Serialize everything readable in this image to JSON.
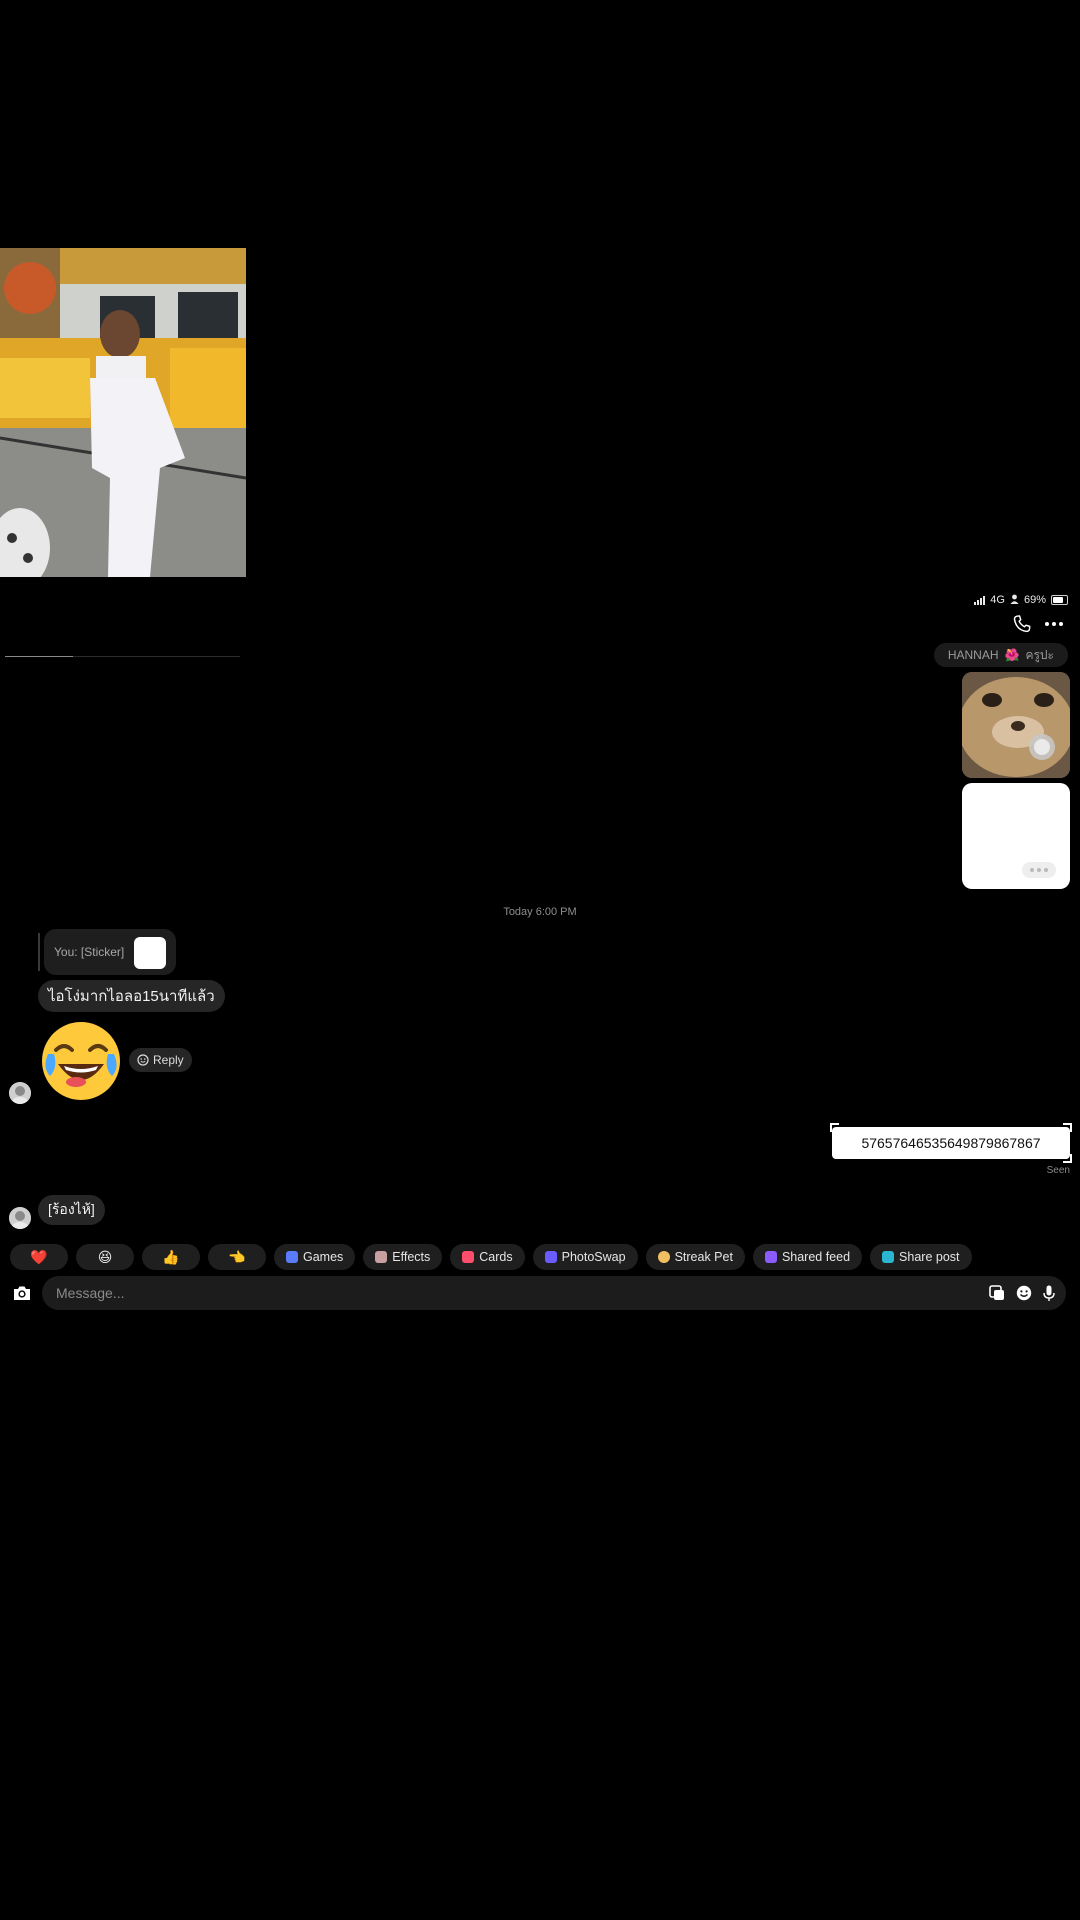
{
  "status_bar": {
    "network": "4G",
    "battery": "69%"
  },
  "chat": {
    "name_pill": "HANNAH",
    "name_pill_emoji": "🌺",
    "name_pill_suffix": "ครูปะ",
    "timestamp": "Today 6:00 PM",
    "reply_quote": "You: [Sticker]",
    "message_1": "ไอโง่มากไอลอ15นาทีแล้ว",
    "reaction_reply_label": "Reply",
    "sent_message": "5765764653564987986786​7",
    "seen_label": "Seen",
    "message_2": "[ร้องไห้]"
  },
  "quick_bar": {
    "emoji_1": "❤️",
    "emoji_2": "😆",
    "emoji_3": "👍",
    "emoji_4": "👈",
    "games": "Games",
    "effects": "Effects",
    "cards": "Cards",
    "photoswap": "PhotoSwap",
    "streak_pet": "Streak Pet",
    "shared_feed": "Shared feed",
    "share_post": "Share post"
  },
  "composer": {
    "placeholder": "Message..."
  },
  "colors": {
    "background": "#000000",
    "bubble_received": "#262626",
    "bubble_sent": "#ffffff"
  }
}
